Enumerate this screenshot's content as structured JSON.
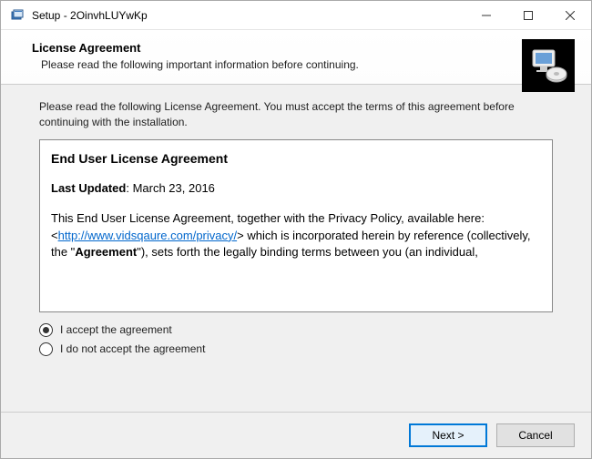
{
  "titlebar": {
    "title": "Setup - 2OinvhLUYwKp"
  },
  "header": {
    "title": "License Agreement",
    "subtitle": "Please read the following important information before continuing."
  },
  "content": {
    "instruction": "Please read the following License Agreement. You must accept the terms of this agreement before continuing with the installation.",
    "eula": {
      "title": "End User License Agreement",
      "updated_label": "Last Updated",
      "updated_value": ": March 23, 2016",
      "body_pre": "This End User License Agreement, together with the Privacy Policy, available here: <",
      "link": "http://www.vidsqaure.com/privacy/",
      "body_post1": "> which is incorporated herein by reference (collectively, the \"",
      "agreement_word": "Agreement",
      "body_post2": "\"), sets forth the legally binding terms between you (an individual,"
    },
    "radios": {
      "accept": "I accept the agreement",
      "decline": "I do not accept the agreement",
      "selected": "accept"
    }
  },
  "footer": {
    "next": "Next >",
    "cancel": "Cancel"
  }
}
